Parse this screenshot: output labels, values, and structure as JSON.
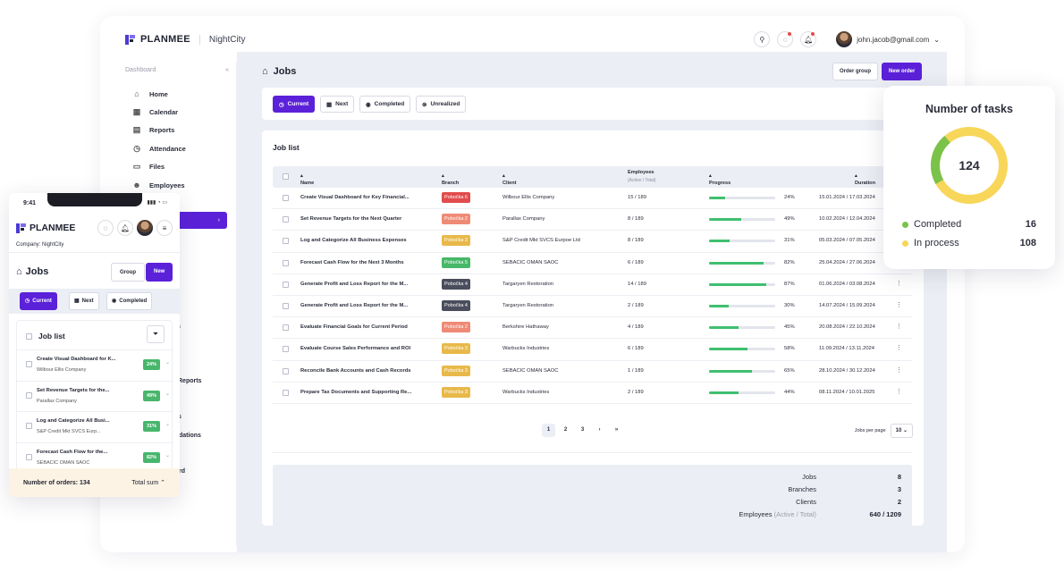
{
  "app": {
    "brand": "PLANMEE",
    "tenant": "NightCity",
    "user_email": "john.jacob@gmail.com",
    "brand_color": "#5b21d9"
  },
  "sidebar": {
    "header": "Dashboard",
    "collapse": "«",
    "items": [
      {
        "label": "Home",
        "icon": "⌂"
      },
      {
        "label": "Calendar",
        "icon": "▦"
      },
      {
        "label": "Reports",
        "icon": "▤"
      },
      {
        "label": "Attendance",
        "icon": "◷"
      },
      {
        "label": "Files",
        "icon": "▭"
      },
      {
        "label": "Employees",
        "icon": "☻"
      }
    ],
    "active_chevron": "›",
    "fragments": [
      "ct",
      "s",
      "Reports",
      "s",
      "dations",
      "rd"
    ]
  },
  "jobs": {
    "title": "Jobs",
    "order_group": "Order group",
    "new_order": "New order",
    "tabs": [
      "Current",
      "Next",
      "Completed",
      "Unrealized"
    ],
    "list_title": "Job list",
    "columns": {
      "name": "Name",
      "branch": "Branch",
      "client": "Client",
      "employees": "Employees",
      "employees_sub": "(Active / Total)",
      "progress": "Progress",
      "duration": "Duration"
    },
    "rows": [
      {
        "name": "Create Visual Dashboard for Key Financial...",
        "branch": "Pobočka 6",
        "branch_color": "#e14c4c",
        "client": "Wilbour Ellis Company",
        "employees": "15 / 189",
        "progress": 24,
        "progress_label": "24%",
        "duration": "15.01.2024 / 17.03.2024"
      },
      {
        "name": "Set Revenue Targets for the Next Quarter",
        "branch": "Pobočka 2",
        "branch_color": "#ee8a76",
        "client": "Parallax Company",
        "employees": "8 / 189",
        "progress": 49,
        "progress_label": "49%",
        "duration": "10.02.2024 / 12.04.2024"
      },
      {
        "name": "Log and Categorize All Business Expenses",
        "branch": "Pobočka 3",
        "branch_color": "#e8b94a",
        "client": "S&P Credit Mkt SVCS Eurpoe Ltd",
        "employees": "8 / 189",
        "progress": 31,
        "progress_label": "31%",
        "duration": "05.03.2024 / 07.05.2024"
      },
      {
        "name": "Forecast Cash Flow for the Next 3 Months",
        "branch": "Pobočka 5",
        "branch_color": "#46b868",
        "client": "SEBACIC OMAN SAOC",
        "employees": "6 / 189",
        "progress": 82,
        "progress_label": "82%",
        "duration": "25.04.2024 / 27.06.2024"
      },
      {
        "name": "Generate Profit and Loss Report for the M...",
        "branch": "Pobočka 4",
        "branch_color": "#4a4d5c",
        "client": "Targaryen Restoration",
        "employees": "14 / 189",
        "progress": 87,
        "progress_label": "87%",
        "duration": "01.06.2024 / 03.08.2024"
      },
      {
        "name": "Generate Profit and Loss Report for the M...",
        "branch": "Pobočka 4",
        "branch_color": "#4a4d5c",
        "client": "Targaryen Restoration",
        "employees": "2 / 189",
        "progress": 30,
        "progress_label": "30%",
        "duration": "14.07.2024 / 15.09.2024"
      },
      {
        "name": "Evaluate Financial Goals for Current Period",
        "branch": "Pobočka 2",
        "branch_color": "#ee8a76",
        "client": "Berkshire Hathaway",
        "employees": "4 / 189",
        "progress": 45,
        "progress_label": "45%",
        "duration": "20.08.2024 / 22.10.2024"
      },
      {
        "name": "Evaluate Course Sales Performance and ROI",
        "branch": "Pobočka 3",
        "branch_color": "#e8b94a",
        "client": "Warbucks Industries",
        "employees": "6 / 189",
        "progress": 58,
        "progress_label": "58%",
        "duration": "11.09.2024 / 13.11.2024"
      },
      {
        "name": "Reconcile Bank Accounts and Cash Records",
        "branch": "Pobočka 3",
        "branch_color": "#e8b94a",
        "client": "SEBACIC OMAN SAOC",
        "employees": "1 / 189",
        "progress": 65,
        "progress_label": "65%",
        "duration": "28.10.2024 / 30.12.2024"
      },
      {
        "name": "Prepare Tax Documents and Supporting Re...",
        "branch": "Pobočka 3",
        "branch_color": "#e8b94a",
        "client": "Warbucks Industries",
        "employees": "2 / 189",
        "progress": 44,
        "progress_label": "44%",
        "duration": "08.11.2024 / 10.01.2025"
      }
    ],
    "pages": [
      "1",
      "2",
      "3"
    ],
    "next": "›",
    "last": "»",
    "per_page_label": "Jobs per page",
    "per_page": "10",
    "summary": {
      "jobs_label": "Jobs",
      "jobs": "8",
      "branches_label": "Branches",
      "branches": "3",
      "clients_label": "Clients",
      "clients": "2",
      "employees_label": "Employees",
      "employees_sub": "(Active / Total)",
      "employees": "640 / 1209"
    }
  },
  "tasks": {
    "title": "Number of tasks",
    "total": "124",
    "completed_label": "Completed",
    "completed": 16,
    "inprocess_label": "In process",
    "inprocess": 108,
    "completed_color": "#7bc24a",
    "inprocess_color": "#f7d65a"
  },
  "mobile": {
    "time": "9:41",
    "status": "▮▮▮ ◔ ▭",
    "brand": "PLANMEE",
    "company": "Company: NightCity",
    "jobs_title": "Jobs",
    "group": "Group",
    "new": "New",
    "tabs": [
      "Current",
      "Next",
      "Completed"
    ],
    "list_title": "Job list",
    "items": [
      {
        "title": "Create Visual Dashboard for K...",
        "client": "Wilbour Ellis Company",
        "pct": "24%"
      },
      {
        "title": "Set Revenue Targets for the...",
        "client": "Parallax Company",
        "pct": "49%"
      },
      {
        "title": "Log and Categorize All Busi...",
        "client": "S&P Credit Mkt SVCS Eurp...",
        "pct": "31%"
      },
      {
        "title": "Forecast Cash Flow for the...",
        "client": "SEBACIC OMAN SAOC",
        "pct": "82%"
      }
    ],
    "footer_orders": "Number of orders: 134",
    "footer_total": "Total sum"
  }
}
